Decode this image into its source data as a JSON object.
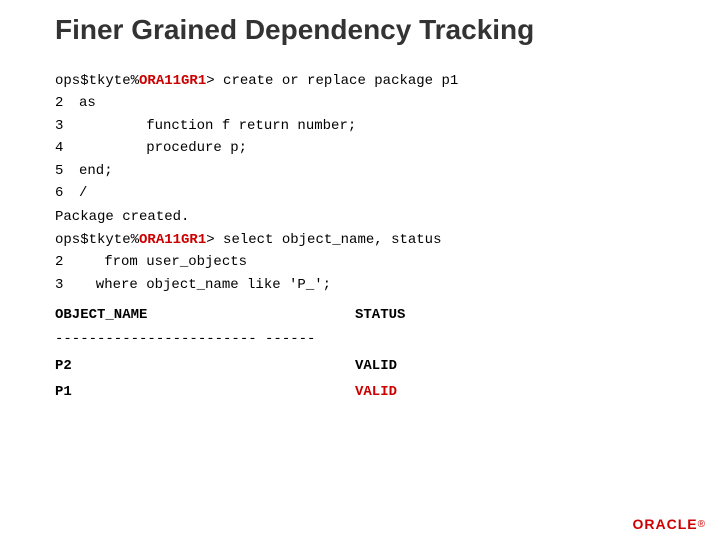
{
  "title": "Finer Grained Dependency Tracking",
  "oracle_logo": "ORACLE",
  "prompt": {
    "prefix": "ops$tkyte%",
    "ora_part": "ORA11GR1",
    "suffix1": "> create or replace package p1",
    "suffix2": "> select object_name, status"
  },
  "code_block1": [
    {
      "num": "2",
      "content": "as"
    },
    {
      "num": "3",
      "content": "        function f return number;"
    },
    {
      "num": "4",
      "content": "        procedure p;"
    },
    {
      "num": "5",
      "content": "end;"
    },
    {
      "num": "6",
      "content": "/"
    }
  ],
  "package_created": "Package created.",
  "code_block2": [
    {
      "num": "2",
      "content": "   from user_objects"
    },
    {
      "num": "3",
      "content": "  where object_name like 'P_';"
    }
  ],
  "col_headers": {
    "name": "OBJECT_NAME",
    "status": "STATUS"
  },
  "divider": "------------------------ ------",
  "data_rows": [
    {
      "name": "P2",
      "status": "VALID",
      "status_red": false
    },
    {
      "name": "P1",
      "status": "VALID",
      "status_red": true
    }
  ]
}
